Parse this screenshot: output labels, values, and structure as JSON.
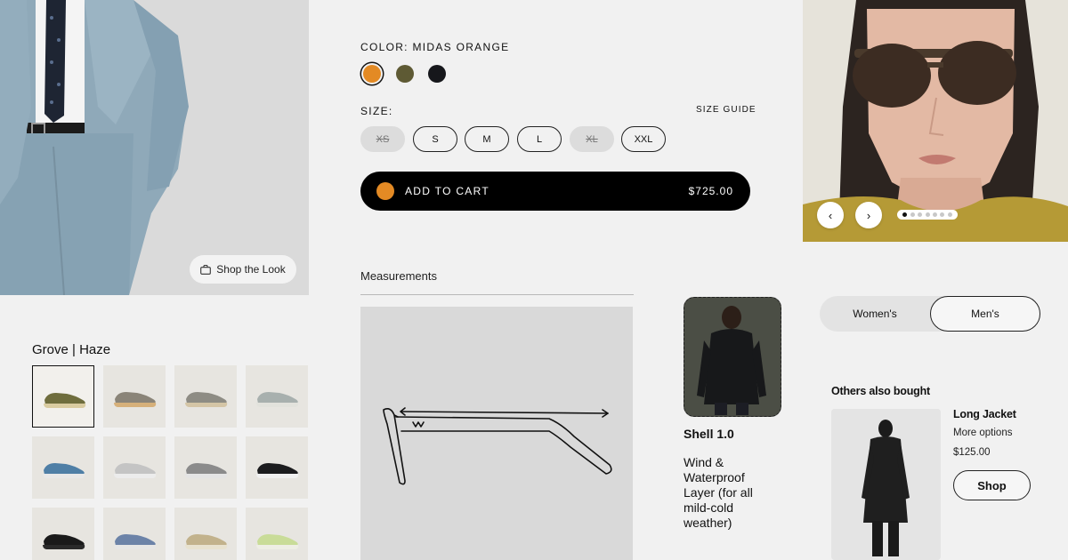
{
  "suit_panel": {
    "shop_the_look_label": "Shop the Look"
  },
  "product_options": {
    "color_label": "COLOR: MIDAS ORANGE",
    "swatches": [
      {
        "color": "#e38a24",
        "selected": true
      },
      {
        "color": "#5e5a34",
        "selected": false
      },
      {
        "color": "#16171b",
        "selected": false
      }
    ],
    "size_label": "SIZE:",
    "size_guide": "SIZE GUIDE",
    "sizes": [
      {
        "label": "XS",
        "available": false
      },
      {
        "label": "S",
        "available": true
      },
      {
        "label": "M",
        "available": true
      },
      {
        "label": "L",
        "available": true
      },
      {
        "label": "XL",
        "available": false
      },
      {
        "label": "XXL",
        "available": true
      }
    ],
    "add_to_cart_label": "ADD TO CART",
    "price": "$725.00"
  },
  "carousel": {
    "prev_icon": "chevron-left-icon",
    "next_icon": "chevron-right-icon",
    "slide_count": 7,
    "active_slide": 1
  },
  "measurements": {
    "title": "Measurements"
  },
  "featured_product": {
    "name": "Shell 1.0",
    "description": "Wind & Waterproof Layer (for all mild-cold weather)"
  },
  "gender_toggle": {
    "options": [
      "Women's",
      "Men's"
    ],
    "active": "Men's"
  },
  "others_also_bought": {
    "title": "Others also bought",
    "product_name": "Long Jacket",
    "more_options": "More options",
    "price": "$125.00",
    "shop_label": "Shop"
  },
  "shoe_grid": {
    "title": "Grove | Haze",
    "variants": [
      {
        "upper": "#6f6d3d",
        "sole": "#d9cba0",
        "selected": true
      },
      {
        "upper": "#8a8478",
        "sole": "#d6b07a",
        "selected": false
      },
      {
        "upper": "#8e8c84",
        "sole": "#d4c5a6",
        "selected": false
      },
      {
        "upper": "#a8b0ae",
        "sole": "#e2e2dc",
        "selected": false
      },
      {
        "upper": "#4f7fa6",
        "sole": "#e8e8e8",
        "selected": false
      },
      {
        "upper": "#c4c4c4",
        "sole": "#ececec",
        "selected": false
      },
      {
        "upper": "#8b8b8b",
        "sole": "#e4e4e4",
        "selected": false
      },
      {
        "upper": "#1c1c1e",
        "sole": "#f0f0f0",
        "selected": false
      },
      {
        "upper": "#1a1a1a",
        "sole": "#2a2a2a",
        "selected": false
      },
      {
        "upper": "#6c83a8",
        "sole": "#e6e6e6",
        "selected": false
      },
      {
        "upper": "#c2b28c",
        "sole": "#e8e2cf",
        "selected": false
      },
      {
        "upper": "#c9dc98",
        "sole": "#eeeee4",
        "selected": false
      }
    ]
  }
}
